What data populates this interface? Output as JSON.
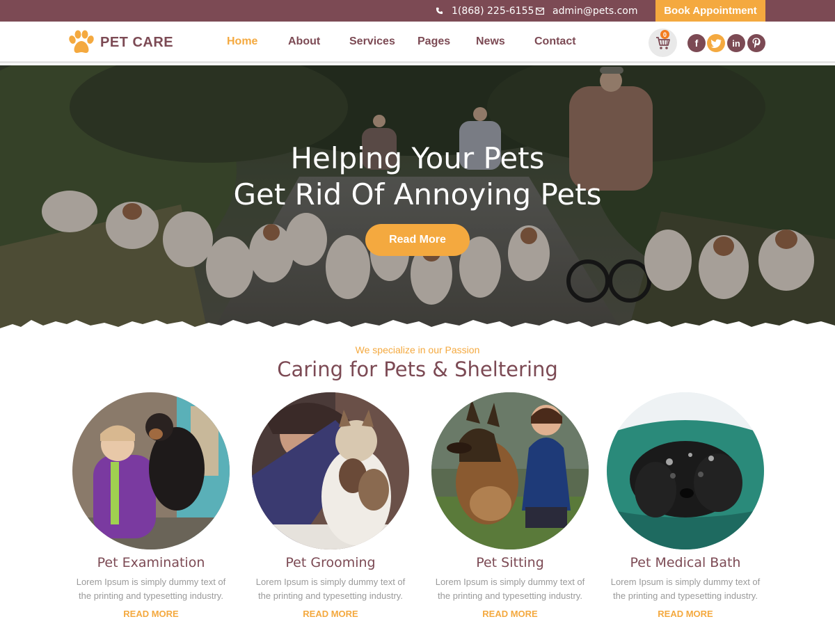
{
  "topbar": {
    "phone": "1(868) 225-6155",
    "email": "admin@pets.com",
    "book_button": "Book Appointment"
  },
  "header": {
    "logo_text": "PET CARE",
    "nav": [
      {
        "label": "Home",
        "active": true
      },
      {
        "label": "About",
        "active": false
      },
      {
        "label": "Services",
        "active": false
      },
      {
        "label": "Pages",
        "active": false
      },
      {
        "label": "News",
        "active": false
      },
      {
        "label": "Contact",
        "active": false
      }
    ],
    "cart_count": "0",
    "social": [
      {
        "icon": "facebook-icon",
        "glyph": "f"
      },
      {
        "icon": "twitter-icon",
        "glyph": ""
      },
      {
        "icon": "linkedin-icon",
        "glyph": "in"
      },
      {
        "icon": "pinterest-icon",
        "glyph": ""
      }
    ]
  },
  "hero": {
    "title_line1": "Helping Your Pets",
    "title_line2": "Get Rid Of Annoying Pets",
    "button": "Read More"
  },
  "services": {
    "subheading": "We specialize in our Passion",
    "heading": "Caring for Pets & Sheltering",
    "cards": [
      {
        "title": "Pet Examination",
        "desc_line1": "Lorem Ipsum is simply dummy text of",
        "desc_line2": "the printing and typesetting industry.",
        "link": "READ MORE"
      },
      {
        "title": "Pet Grooming",
        "desc_line1": "Lorem Ipsum is simply dummy text of",
        "desc_line2": "the printing and typesetting industry.",
        "link": "READ MORE"
      },
      {
        "title": "Pet Sitting",
        "desc_line1": "Lorem Ipsum is simply dummy text of",
        "desc_line2": "the printing and typesetting industry.",
        "link": "READ MORE"
      },
      {
        "title": "Pet Medical Bath",
        "desc_line1": "Lorem Ipsum is simply dummy text of",
        "desc_line2": "the printing and typesetting industry.",
        "link": "READ MORE"
      }
    ]
  },
  "colors": {
    "brand": "#7c4a54",
    "accent": "#f4a93f",
    "muted_text": "#9a9a9a"
  }
}
